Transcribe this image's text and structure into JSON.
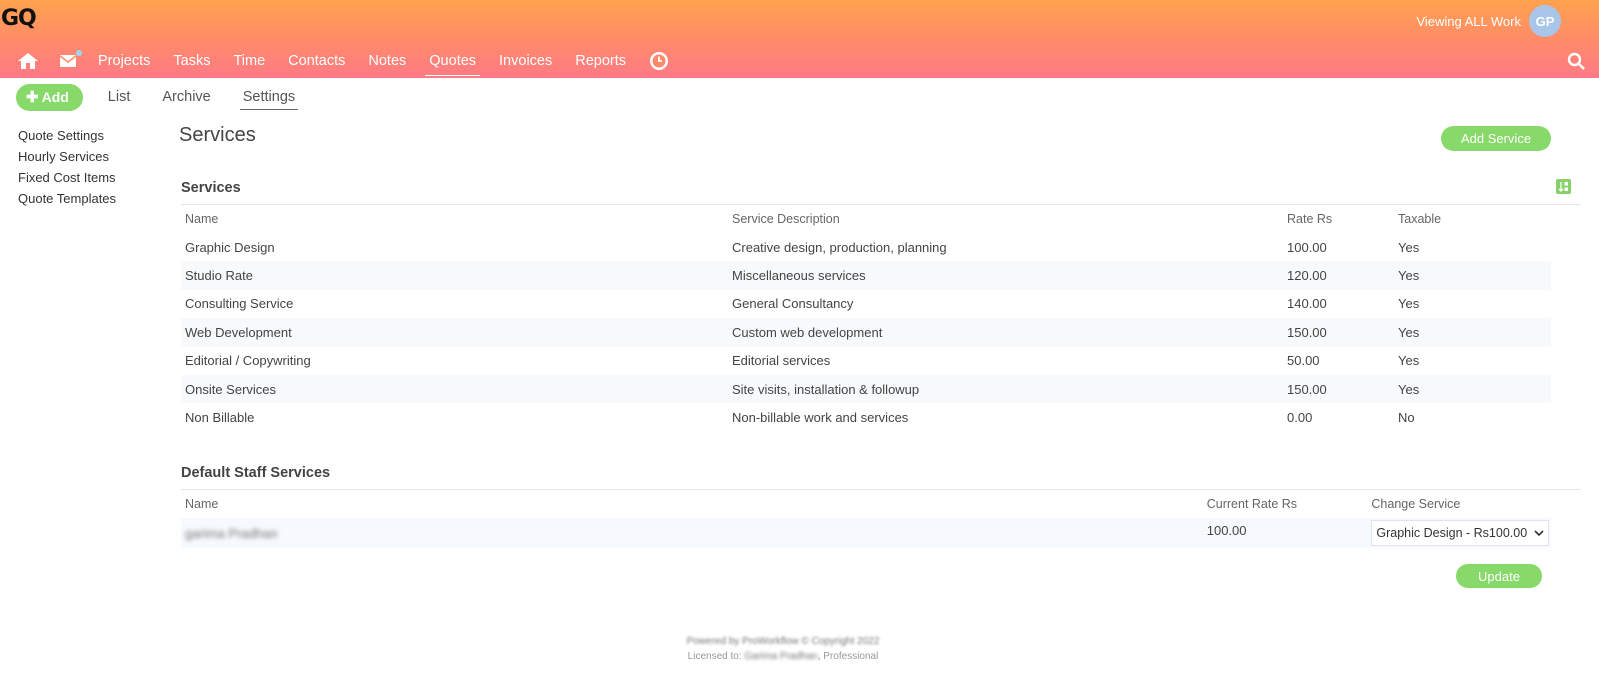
{
  "brand": {
    "logo": "GQ"
  },
  "header": {
    "viewing": "Viewing ALL Work",
    "avatar": "GP"
  },
  "nav": {
    "items": [
      "Projects",
      "Tasks",
      "Time",
      "Contacts",
      "Notes",
      "Quotes",
      "Invoices",
      "Reports"
    ],
    "active": "Quotes",
    "icons": [
      "home-icon",
      "mail-icon",
      "clock-icon",
      "search-icon"
    ]
  },
  "subnav": {
    "add": "Add",
    "items": [
      "List",
      "Archive",
      "Settings"
    ],
    "active": "Settings"
  },
  "sidebar": {
    "items": [
      "Quote Settings",
      "Hourly Services",
      "Fixed Cost Items",
      "Quote Templates"
    ]
  },
  "page": {
    "title": "Services",
    "add_service": "Add Service"
  },
  "services": {
    "title": "Services",
    "columns": [
      "Name",
      "Service Description",
      "Rate Rs",
      "Taxable"
    ],
    "rows": [
      [
        "Graphic Design",
        "Creative design, production, planning",
        "100.00",
        "Yes"
      ],
      [
        "Studio Rate",
        "Miscellaneous services",
        "120.00",
        "Yes"
      ],
      [
        "Consulting Service",
        "General Consultancy",
        "140.00",
        "Yes"
      ],
      [
        "Web Development",
        "Custom web development",
        "150.00",
        "Yes"
      ],
      [
        "Editorial / Copywriting",
        "Editorial services",
        "50.00",
        "Yes"
      ],
      [
        "Onsite Services",
        "Site visits, installation & followup",
        "150.00",
        "Yes"
      ],
      [
        "Non Billable",
        "Non-billable work and services",
        "0.00",
        "No"
      ]
    ]
  },
  "staff": {
    "title": "Default Staff Services",
    "columns": [
      "Name",
      "Current Rate Rs",
      "Change Service"
    ],
    "rows": [
      [
        "garima Pradhan",
        "100.00",
        "Graphic Design - Rs100.00"
      ]
    ],
    "update": "Update"
  },
  "footer": {
    "line1": "Powered by ProWorkflow © Copyright 2022",
    "line2_prefix": "Licensed to:",
    "line2_name": "Garima Pradhan",
    "line2_suffix": ", Professional"
  },
  "colors": {
    "accent_green": "#87d96a",
    "header_top": "#ffa24e",
    "header_bottom": "#ff7a86"
  }
}
